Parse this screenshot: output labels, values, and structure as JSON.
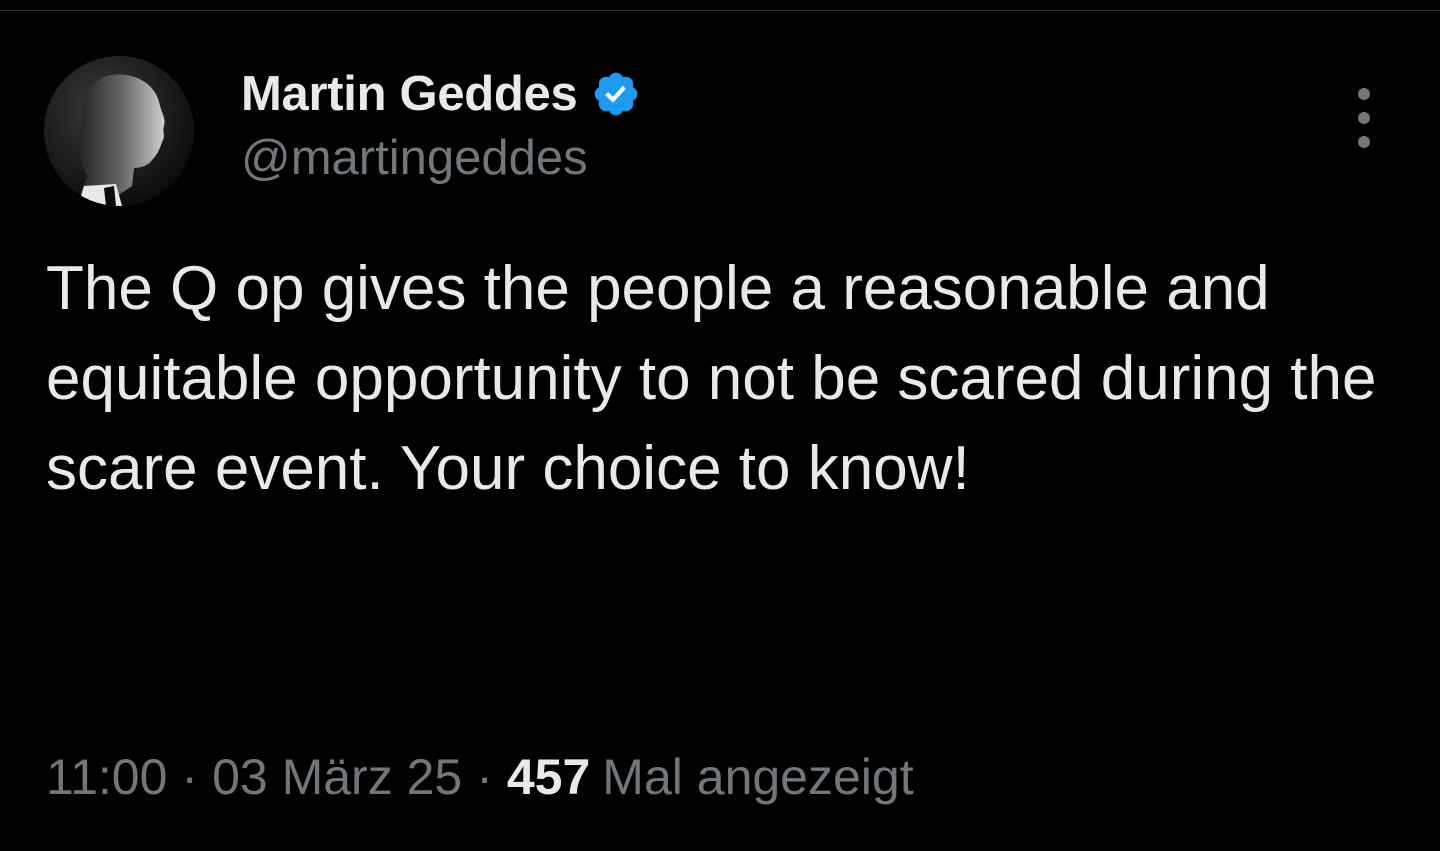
{
  "author": {
    "display_name": "Martin Geddes",
    "handle": "@martingeddes",
    "verified": true,
    "avatar_icon": "portrait-avatar",
    "verified_icon": "verified-badge-icon"
  },
  "tweet": {
    "text": "The Q op gives the people a reasonable and equitable opportunity to not be scared during the scare event. Your choice to know!"
  },
  "meta": {
    "time": "11:00",
    "separator": "·",
    "date": "03 März 25",
    "views_count": "457",
    "views_label": "Mal angezeigt"
  },
  "menu": {
    "more_icon": "more-options-icon"
  },
  "colors": {
    "background": "#000000",
    "primary_text": "#e7e9ea",
    "secondary_text": "#71767b",
    "verified_blue": "#1d9bf0",
    "divider": "#2f3336"
  }
}
